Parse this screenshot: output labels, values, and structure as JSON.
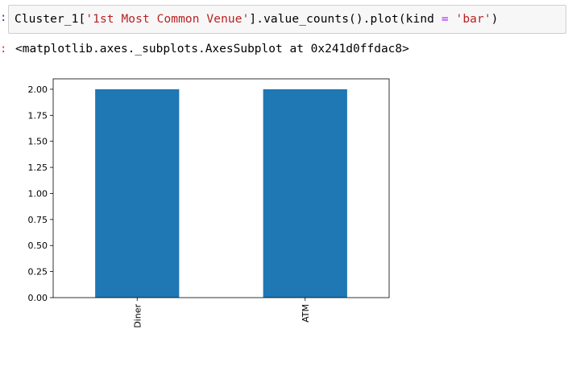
{
  "cell": {
    "prompt_in": ":",
    "prompt_out": ":",
    "code": {
      "obj": "Cluster_1[",
      "key": "'1st Most Common Venue'",
      "mid": "].value_counts().plot(kind ",
      "eq": "=",
      "arg": "'bar'",
      "close": ")"
    },
    "output_repr": "<matplotlib.axes._subplots.AxesSubplot at 0x241d0ffdac8>"
  },
  "colors": {
    "bar": "#1f77b4",
    "string_token": "#ba2121",
    "operator_token": "#aa22ff"
  },
  "chart_data": {
    "type": "bar",
    "categories": [
      "Diner",
      "ATM"
    ],
    "values": [
      2,
      2
    ],
    "ylim": [
      0,
      2.1
    ],
    "yticks": [
      "0.00",
      "0.25",
      "0.50",
      "0.75",
      "1.00",
      "1.25",
      "1.50",
      "1.75",
      "2.00"
    ],
    "title": "",
    "xlabel": "",
    "ylabel": "",
    "grid": false,
    "legend": "none",
    "xtick_rotation": "vertical"
  }
}
